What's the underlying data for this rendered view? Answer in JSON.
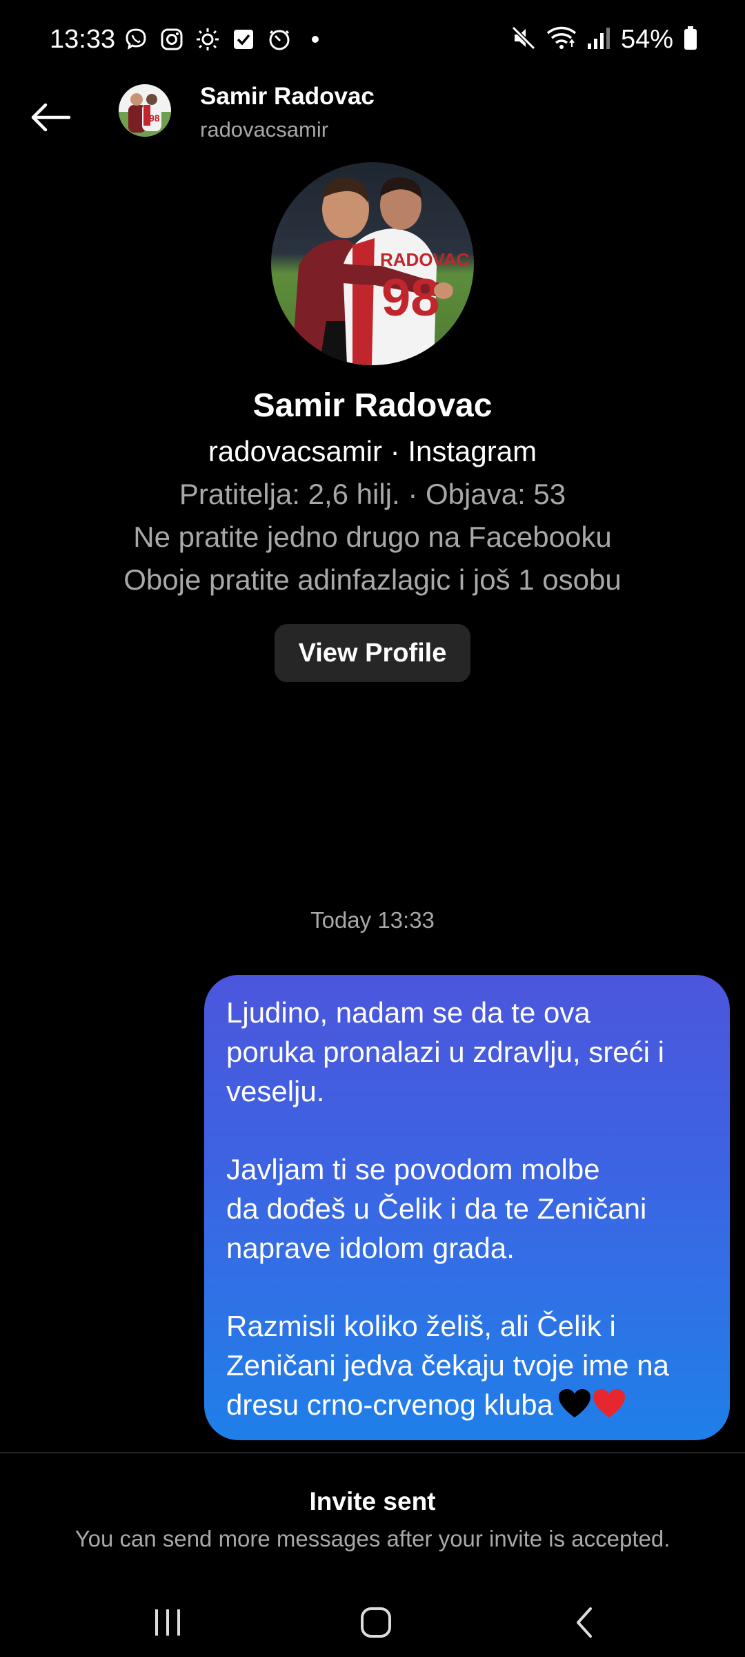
{
  "status_bar": {
    "time": "13:33",
    "battery": "54%",
    "left_icons": [
      "viber-icon",
      "instagram-icon",
      "brightness-icon",
      "checkbox-icon",
      "timer-icon",
      "dot-icon"
    ],
    "right_icons": [
      "mute-icon",
      "wifi-icon",
      "signal-icon",
      "battery-icon"
    ]
  },
  "header": {
    "name": "Samir Radovac",
    "username": "radovacsamir"
  },
  "profile": {
    "name": "Samir Radovac",
    "source_line": "radovacsamir · Instagram",
    "stats_line": "Pratitelja: 2,6 hilj. · Objava: 53",
    "facebook_line": "Ne pratite jedno drugo na Facebooku",
    "mutual_line": "Oboje pratite adinfazlagic i još 1 osobu",
    "view_profile_label": "View Profile",
    "jersey_text": "RADOVAC",
    "jersey_number": "98"
  },
  "conversation": {
    "timestamp": "Today 13:33",
    "message": {
      "paragraph1": "Ljudino, nadam se da te ova\nporuka pronalazi u zdravlju, sreći i\nveselju.",
      "paragraph2": "Javljam ti se povodom molbe\nda dođeš u Čelik i da te Zeničani\nnaprave idolom grada.",
      "paragraph3": "Razmisli koliko želiš, ali Čelik i\nZeničani jedva čekaju tvoje ime na\ndresu crno-crvenog kluba",
      "emoji": [
        "black-heart-icon",
        "red-heart-icon"
      ]
    }
  },
  "footer": {
    "invite_title": "Invite sent",
    "invite_subtitle": "You can send more messages after your invite is accepted."
  },
  "nav": {
    "buttons": [
      "recent-apps-icon",
      "home-icon",
      "back-nav-icon"
    ]
  },
  "colors": {
    "background": "#000000",
    "secondary_text": "#a8a8a8",
    "button_bg": "#262626",
    "bubble_top": "#4c56dc",
    "bubble_bottom": "#1f7fe8"
  }
}
